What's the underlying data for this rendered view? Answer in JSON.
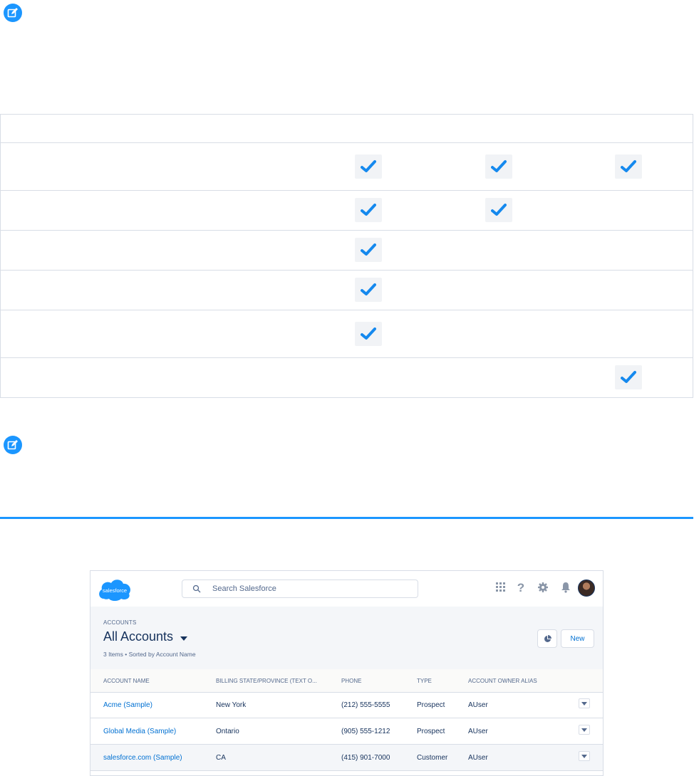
{
  "matrix": {
    "rows": [
      {
        "checks": [
          true,
          true,
          true
        ]
      },
      {
        "checks": [
          true,
          true,
          false
        ]
      },
      {
        "checks": [
          true,
          false,
          false
        ]
      },
      {
        "checks": [
          true,
          false,
          false
        ]
      },
      {
        "checks": [
          true,
          false,
          false
        ]
      },
      {
        "checks": [
          false,
          false,
          true
        ]
      }
    ]
  },
  "salesforce": {
    "logo_text": "salesforce",
    "search_placeholder": "Search Salesforce",
    "object_label": "ACCOUNTS",
    "view_title": "All Accounts",
    "list_meta": "3 Items • Sorted by Account Name",
    "new_button": "New",
    "columns": [
      "ACCOUNT NAME",
      "BILLING STATE/PROVINCE (TEXT O...",
      "PHONE",
      "TYPE",
      "ACCOUNT OWNER ALIAS"
    ],
    "rows": [
      {
        "name": "Acme (Sample)",
        "state": "New York",
        "phone": "(212) 555-5555",
        "type": "Prospect",
        "owner": "AUser"
      },
      {
        "name": "Global Media (Sample)",
        "state": "Ontario",
        "phone": "(905) 555-1212",
        "type": "Prospect",
        "owner": "AUser"
      },
      {
        "name": "salesforce.com (Sample)",
        "state": "CA",
        "phone": "(415) 901-7000",
        "type": "Customer",
        "owner": "AUser"
      }
    ]
  },
  "colors": {
    "accent": "#1b96ff",
    "link": "#0070d2",
    "text": "#16325c",
    "check": "#1589ee"
  }
}
